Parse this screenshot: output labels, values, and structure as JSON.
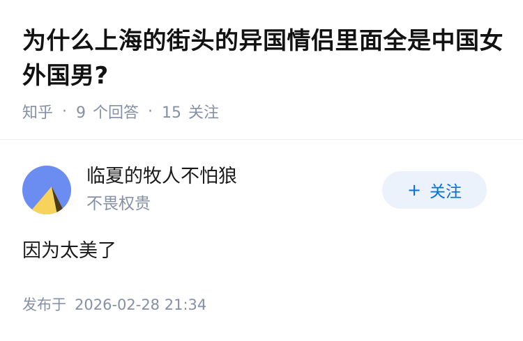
{
  "question": {
    "title": "为什么上海的街头的异国情侣里面全是中国女外国男?",
    "source": "知乎",
    "separator": "·",
    "answer_count": "9",
    "answer_label": "个回答",
    "follower_count": "15",
    "follower_label": "关注"
  },
  "answer": {
    "author": {
      "name": "临夏的牧人不怕狼",
      "bio": "不畏权贵",
      "avatar_icon": "avatar-mountain-icon"
    },
    "follow_button": {
      "icon": "plus-icon",
      "plus": "+",
      "label": "关注"
    },
    "content": "因为太美了",
    "published_label": "发布于",
    "published_time": "2026-02-28 21:34"
  },
  "colors": {
    "accent": "#056de8",
    "follow_bg": "#ebf2fb",
    "meta_text": "#8590a6",
    "avatar_sky": "#6b8cf0",
    "avatar_sun": "#f7d35b",
    "avatar_shadow": "#4a3a17"
  }
}
